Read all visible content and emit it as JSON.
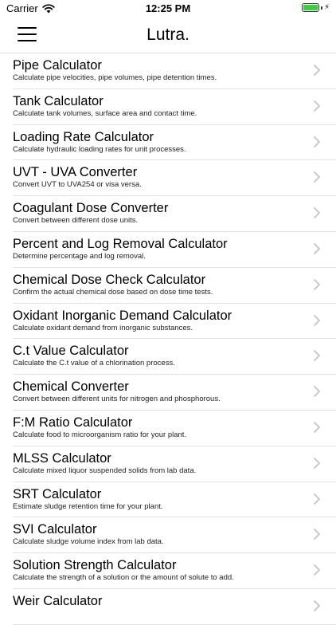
{
  "status": {
    "carrier": "Carrier",
    "time": "12:25 PM",
    "battery_level": 1.0
  },
  "nav": {
    "title": "Lutra."
  },
  "rows": [
    {
      "title": "Pipe Calculator",
      "subtitle": "Calculate pipe velocities, pipe volumes, pipe detention times."
    },
    {
      "title": "Tank Calculator",
      "subtitle": "Calculate tank volumes, surface area and contact time."
    },
    {
      "title": "Loading Rate Calculator",
      "subtitle": "Calculate hydraulic loading rates for unit processes."
    },
    {
      "title": "UVT - UVA Converter",
      "subtitle": "Convert UVT to UVA254 or visa versa."
    },
    {
      "title": "Coagulant Dose Converter",
      "subtitle": "Convert between different dose units."
    },
    {
      "title": "Percent and Log Removal Calculator",
      "subtitle": "Determine percentage and log removal."
    },
    {
      "title": "Chemical Dose Check Calculator",
      "subtitle": "Confirm the actual chemical dose based on dose time tests."
    },
    {
      "title": "Oxidant Inorganic Demand Calculator",
      "subtitle": "Calculate oxidant demand from inorganic substances."
    },
    {
      "title": "C.t Value Calculator",
      "subtitle": "Calculate the C.t value of a chlorination process."
    },
    {
      "title": "Chemical Converter",
      "subtitle": "Convert between different units for nitrogen and phosphorous."
    },
    {
      "title": "F:M Ratio Calculator",
      "subtitle": "Calculate food to microorganism ratio for your plant."
    },
    {
      "title": "MLSS Calculator",
      "subtitle": "Calculate mixed liquor suspended solids from lab data."
    },
    {
      "title": "SRT Calculator",
      "subtitle": "Estimate sludge retention time for your plant."
    },
    {
      "title": "SVI Calculator",
      "subtitle": "Calculate sludge volume index from lab data."
    },
    {
      "title": "Solution Strength Calculator",
      "subtitle": "Calculate the strength of a solution or the amount of solute to add."
    },
    {
      "title": "Weir Calculator",
      "subtitle": ""
    }
  ],
  "colors": {
    "separator": "#e2e2e2",
    "chevron": "#c4c4c9",
    "battery": "#3fcc3f"
  },
  "icons": {
    "menu": "hamburger-menu-icon",
    "row_accessory": "chevron-right-icon",
    "wifi": "wifi-icon",
    "battery": "battery-icon"
  }
}
